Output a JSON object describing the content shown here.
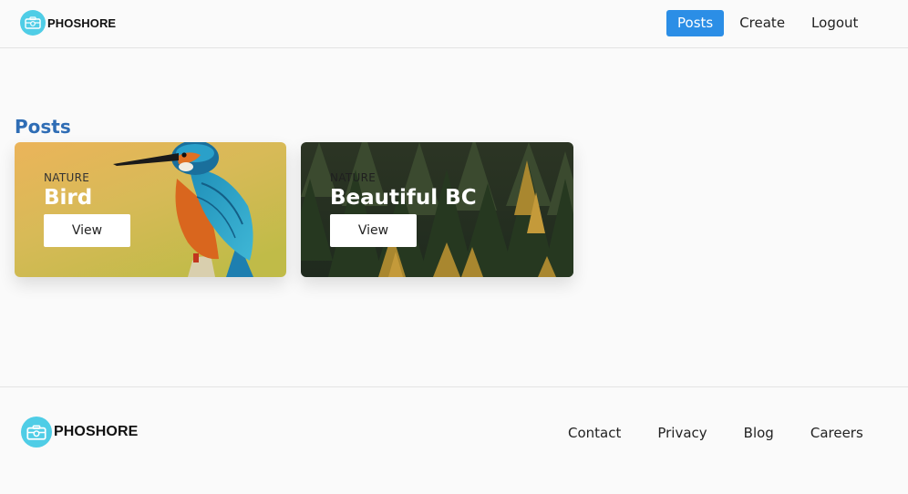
{
  "brand": {
    "name": "PHOSHORE",
    "logo_icon": "camera-icon",
    "logo_color": "#4fcde6"
  },
  "nav": {
    "items": [
      {
        "label": "Posts",
        "active": true
      },
      {
        "label": "Create",
        "active": false
      },
      {
        "label": "Logout",
        "active": false
      }
    ],
    "active_color": "#2b8ee6"
  },
  "main": {
    "title": "Posts",
    "title_color": "#2f6db5",
    "cards": [
      {
        "category": "NATURE",
        "title": "Bird",
        "button_label": "View",
        "image": "kingfisher-photo"
      },
      {
        "category": "NATURE",
        "title": "Beautiful BC",
        "button_label": "View",
        "image": "forest-photo"
      }
    ]
  },
  "footer": {
    "brand_name": "PHOSHORE",
    "links": [
      "Contact",
      "Privacy",
      "Blog",
      "Careers"
    ]
  }
}
